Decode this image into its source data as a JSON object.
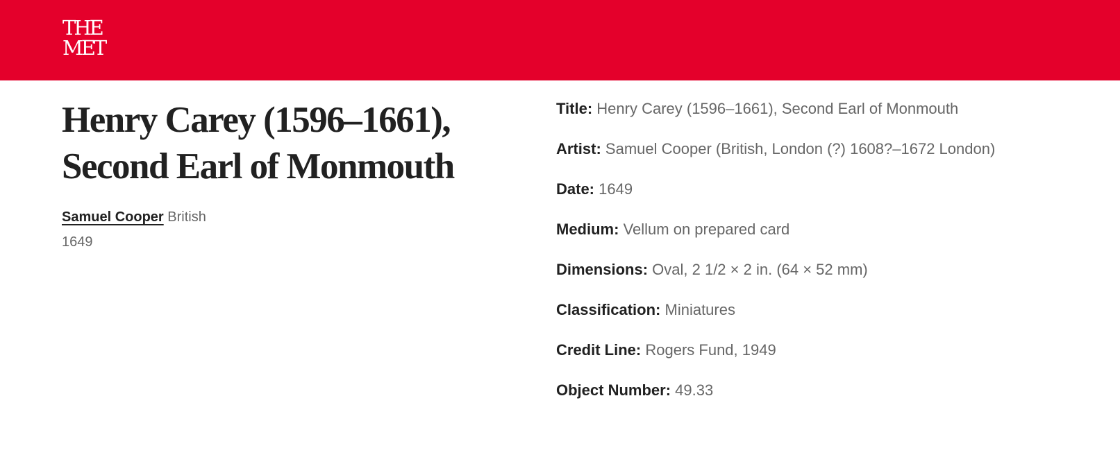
{
  "header": {
    "logo": {
      "line1": "THE",
      "line2": "MET",
      "color": "#e4002b"
    }
  },
  "artwork": {
    "title": "Henry Carey (1596–1661), Second Earl of Monmouth",
    "artist_name": "Samuel Cooper",
    "artist_nationality": "British",
    "date": "1649"
  },
  "details": [
    {
      "label": "Title:",
      "value": "Henry Carey (1596–1661), Second Earl of Monmouth"
    },
    {
      "label": "Artist:",
      "value": "Samuel Cooper (British, London (?) 1608?–1672 London)"
    },
    {
      "label": "Date:",
      "value": "1649"
    },
    {
      "label": "Medium:",
      "value": "Vellum on prepared card"
    },
    {
      "label": "Dimensions:",
      "value": "Oval, 2 1/2 × 2 in. (64 × 52 mm)"
    },
    {
      "label": "Classification:",
      "value": "Miniatures"
    },
    {
      "label": "Credit Line:",
      "value": "Rogers Fund, 1949"
    },
    {
      "label": "Object Number:",
      "value": "49.33"
    }
  ]
}
